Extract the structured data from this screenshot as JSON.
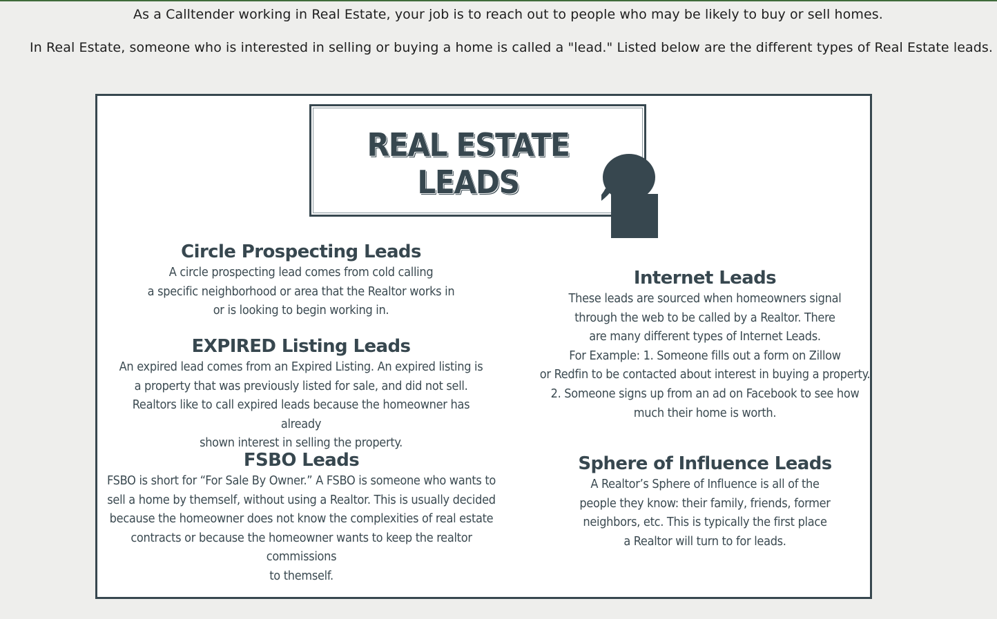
{
  "intro": {
    "line1": "As a Calltender working in Real Estate, your job is to reach out to people who may be likely to buy or sell homes.",
    "line2": "In Real Estate, someone who is interested in selling or buying a home is called a \"lead.\" Listed below are the different types of Real Estate leads."
  },
  "infographic": {
    "title": "REAL ESTATE LEADS",
    "sections": {
      "circle": {
        "heading": "Circle Prospecting Leads",
        "body": "A circle prospecting lead comes from cold calling\na specific neighborhood or area that the Realtor works in\nor is looking to begin working in."
      },
      "expired": {
        "heading": "EXPIRED Listing Leads",
        "body": "An expired lead comes from an Expired Listing. An expired listing is\na property that was previously listed for sale, and did not sell.\nRealtors like to call expired leads because the homeowner has already\nshown interest in selling the property."
      },
      "fsbo": {
        "heading": "FSBO Leads",
        "body": "FSBO is short for “For Sale By Owner.” A FSBO is someone who wants to\nsell a home by themself, without using a Realtor. This is usually decided\nbecause the homeowner does not know the complexities of real estate\ncontracts or because the homeowner wants to keep the realtor commissions\nto themself."
      },
      "internet": {
        "heading": "Internet Leads",
        "body": "These leads are sourced when homeowners signal\nthrough the web to be called by a Realtor. There\nare many different types of Internet Leads.\nFor Example: 1. Someone fills out a form on Zillow\nor Redfin to be contacted about interest in buying a property.\n2. Someone signs up from an ad on Facebook to see how\nmuch their home is worth."
      },
      "sphere": {
        "heading": "Sphere of Influence Leads",
        "body": "A Realtor’s Sphere of Influence is all of the\npeople they know: their family, friends, former\nneighbors, etc. This is typically the first place\na Realtor will turn to for leads."
      }
    }
  },
  "colors": {
    "page_background": "#eeeeec",
    "ink": "#37474f",
    "top_border": "#3f6b3a"
  }
}
